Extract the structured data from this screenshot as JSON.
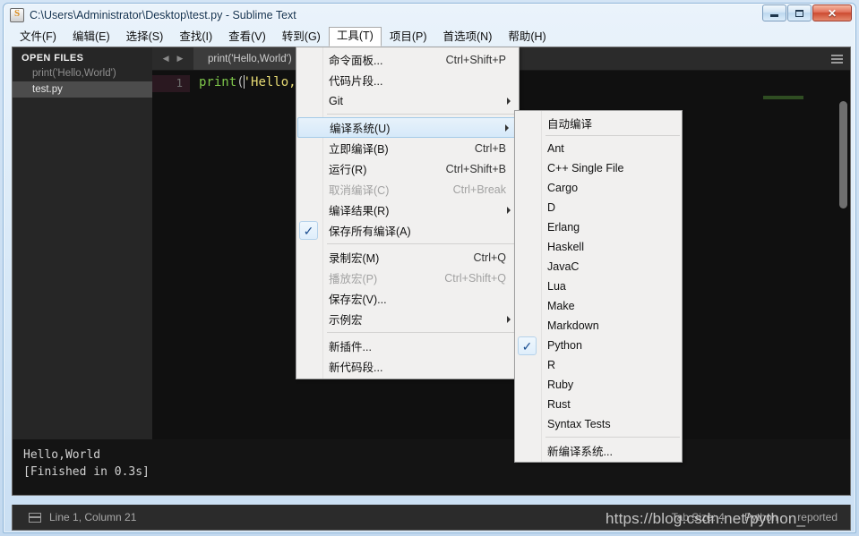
{
  "window": {
    "title": "C:\\Users\\Administrator\\Desktop\\test.py - Sublime Text",
    "app_icon": "sublime-logo-icon",
    "minimize_label": "Minimize",
    "maximize_label": "Maximize",
    "close_label": "✕"
  },
  "menubar": {
    "items": [
      {
        "label": "文件(F)",
        "open": false
      },
      {
        "label": "编辑(E)",
        "open": false
      },
      {
        "label": "选择(S)",
        "open": false
      },
      {
        "label": "查找(I)",
        "open": false
      },
      {
        "label": "查看(V)",
        "open": false
      },
      {
        "label": "转到(G)",
        "open": false
      },
      {
        "label": "工具(T)",
        "open": true
      },
      {
        "label": "项目(P)",
        "open": false
      },
      {
        "label": "首选项(N)",
        "open": false
      },
      {
        "label": "帮助(H)",
        "open": false
      }
    ]
  },
  "sidebar": {
    "header": "OPEN FILES",
    "items": [
      {
        "label": "print('Hello,World')",
        "selected": false
      },
      {
        "label": "test.py",
        "selected": true
      }
    ]
  },
  "tabbar": {
    "prev_icon": "arrow-left-icon",
    "next_icon": "arrow-right-icon",
    "menu_icon": "hamburger-icon",
    "tabs": [
      {
        "label": "print('Hello,World')",
        "active": true
      }
    ]
  },
  "editor": {
    "line_number": "1",
    "code_tokens": {
      "fn": "print",
      "open_paren": "(",
      "string": "'Hello,Wo"
    }
  },
  "console": {
    "lines": [
      "Hello,World",
      "[Finished in 0.3s]"
    ]
  },
  "statusbar": {
    "layout_icon": "panel-layout-icon",
    "position": "Line 1, Column 21",
    "tab_size": "Tab Size: 4",
    "syntax": "Python",
    "extra": "reported"
  },
  "watermark": {
    "text": "https://blog.csdn.net/python_"
  },
  "tools_menu": {
    "groups": [
      {
        "rows": [
          {
            "label": "命令面板...",
            "accel": "Ctrl+Shift+P",
            "submenu": false,
            "checked": false,
            "disabled": false,
            "highlight": false
          },
          {
            "label": "代码片段...",
            "accel": "",
            "submenu": false,
            "checked": false,
            "disabled": false,
            "highlight": false
          },
          {
            "label": "Git",
            "accel": "",
            "submenu": true,
            "checked": false,
            "disabled": false,
            "highlight": false
          }
        ]
      },
      {
        "rows": [
          {
            "label": "编译系统(U)",
            "accel": "",
            "submenu": true,
            "checked": false,
            "disabled": false,
            "highlight": true
          },
          {
            "label": "立即编译(B)",
            "accel": "Ctrl+B",
            "submenu": false,
            "checked": false,
            "disabled": false,
            "highlight": false
          },
          {
            "label": "运行(R)",
            "accel": "Ctrl+Shift+B",
            "submenu": false,
            "checked": false,
            "disabled": false,
            "highlight": false
          },
          {
            "label": "取消编译(C)",
            "accel": "Ctrl+Break",
            "submenu": false,
            "checked": false,
            "disabled": true,
            "highlight": false
          },
          {
            "label": "编译结果(R)",
            "accel": "",
            "submenu": true,
            "checked": false,
            "disabled": false,
            "highlight": false
          },
          {
            "label": "保存所有编译(A)",
            "accel": "",
            "submenu": false,
            "checked": true,
            "disabled": false,
            "highlight": false
          }
        ]
      },
      {
        "rows": [
          {
            "label": "录制宏(M)",
            "accel": "Ctrl+Q",
            "submenu": false,
            "checked": false,
            "disabled": false,
            "highlight": false
          },
          {
            "label": "播放宏(P)",
            "accel": "Ctrl+Shift+Q",
            "submenu": false,
            "checked": false,
            "disabled": true,
            "highlight": false
          },
          {
            "label": "保存宏(V)...",
            "accel": "",
            "submenu": false,
            "checked": false,
            "disabled": false,
            "highlight": false
          },
          {
            "label": "示例宏",
            "accel": "",
            "submenu": true,
            "checked": false,
            "disabled": false,
            "highlight": false
          }
        ]
      },
      {
        "rows": [
          {
            "label": "新插件...",
            "accel": "",
            "submenu": false,
            "checked": false,
            "disabled": false,
            "highlight": false
          },
          {
            "label": "新代码段...",
            "accel": "",
            "submenu": false,
            "checked": false,
            "disabled": false,
            "highlight": false
          }
        ]
      }
    ]
  },
  "build_menu": {
    "groups": [
      {
        "rows": [
          {
            "label": "自动编译",
            "checked": false
          }
        ]
      },
      {
        "rows": [
          {
            "label": "Ant",
            "checked": false
          },
          {
            "label": "C++ Single File",
            "checked": false
          },
          {
            "label": "Cargo",
            "checked": false
          },
          {
            "label": "D",
            "checked": false
          },
          {
            "label": "Erlang",
            "checked": false
          },
          {
            "label": "Haskell",
            "checked": false
          },
          {
            "label": "JavaC",
            "checked": false
          },
          {
            "label": "Lua",
            "checked": false
          },
          {
            "label": "Make",
            "checked": false
          },
          {
            "label": "Markdown",
            "checked": false
          },
          {
            "label": "Python",
            "checked": true
          },
          {
            "label": "R",
            "checked": false
          },
          {
            "label": "Ruby",
            "checked": false
          },
          {
            "label": "Rust",
            "checked": false
          },
          {
            "label": "Syntax Tests",
            "checked": false
          }
        ]
      },
      {
        "rows": [
          {
            "label": "新编译系统...",
            "checked": false
          }
        ]
      }
    ]
  },
  "colors": {
    "accent": "#4a90d9",
    "editor_bg": "#101010",
    "sidebar_bg": "#262626",
    "string_token": "#e7db74",
    "function_token": "#7ec64a",
    "menu_bg": "#f1f0ef"
  }
}
